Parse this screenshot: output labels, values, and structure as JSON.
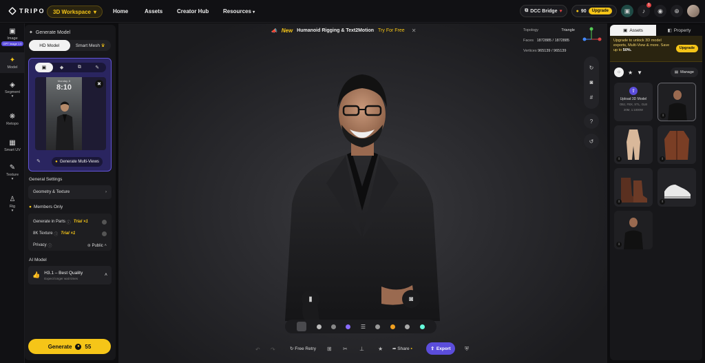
{
  "app": {
    "logo": "TRIPO",
    "workspace": "3D Workspace"
  },
  "nav": [
    "Home",
    "Assets",
    "Creator Hub",
    "Resources"
  ],
  "top_right": {
    "dcc": "DCC Bridge",
    "credits": "90",
    "upgrade": "Upgrade",
    "notif_count": "1"
  },
  "rail": [
    {
      "label": "Image",
      "tag": "GPT Image 1.5"
    },
    {
      "label": "Model"
    },
    {
      "label": "Segment"
    },
    {
      "label": "Retopo"
    },
    {
      "label": "Smart UV"
    },
    {
      "label": "Texture"
    },
    {
      "label": "Rig"
    }
  ],
  "panel": {
    "title": "Generate Model",
    "tabs": [
      "HD Model",
      "Smart Mesh"
    ],
    "phone_day": "Monday, 6",
    "phone_time": "8:10",
    "gen_mv": "Generate Multi-Views",
    "general_settings": "General Settings",
    "geometry": "Geometry & Texture",
    "members_only": "Members Only",
    "gen_parts": "Generate in Parts",
    "trial1": "Trial ×1",
    "tex8k": "8K Texture",
    "trial2": "Trial ×1",
    "privacy": "Privacy",
    "privacy_val": "Public",
    "ai_model": "AI Model",
    "model_name": "H3.1 – Best Quality",
    "model_sub": "Expect longer wait times",
    "generate": "Generate",
    "cost": "55"
  },
  "banner": {
    "new": "New",
    "text": "Humanoid Rigging & Text2Motion",
    "try": "Try For Free"
  },
  "stats": {
    "topology_label": "Topology",
    "topology": "Triangle",
    "faces_label": "Faces",
    "faces": "1872885 / 1872885",
    "vertices_label": "Vertices",
    "vertices": "965139 / 965139"
  },
  "bottom": {
    "retry": "Free Retry",
    "share": "Share",
    "export": "Export"
  },
  "right": {
    "tabs": [
      "Assets",
      "Property"
    ],
    "promo": "Upgrade to unlock 3D model exports, Multi-View & more. Save up to ",
    "promo_pct": "50%.",
    "upgrade": "Upgrade",
    "manage": "Manage",
    "upload_title": "Upload 3D Model",
    "upload_fmt": "OBJ, FBX, STL, GLB",
    "upload_size": "20M, 1:1000W"
  },
  "colors": {
    "accent": "#f5c518",
    "purple": "#5b4ddb"
  }
}
